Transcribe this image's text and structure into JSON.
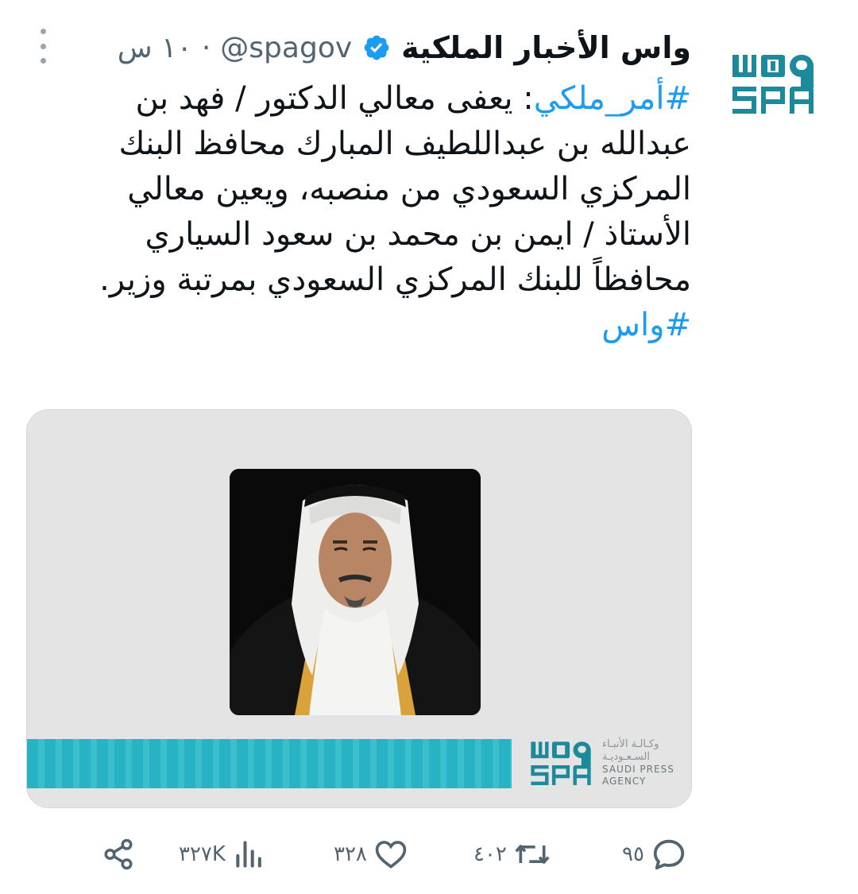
{
  "account": {
    "display_name": "واس الأخبار الملكية",
    "handle": "@spagov",
    "separator": "·",
    "time": "١٠ س",
    "avatar": "spa-logo",
    "verified_color": "#1d9bf0"
  },
  "tweet": {
    "hashtag_prefix": "#أمر_ملكي",
    "lines": [
      ": يعفى معالي الدكتور / فهد بن",
      "عبدالله بن عبداللطيف المبارك محافظ البنك",
      "المركزي السعودي من منصبه، ويعين معالي",
      "الأستاذ / ايمن بن محمد بن سعود السياري",
      "محافظاً للبنك المركزي السعودي بمرتبة وزير."
    ],
    "hashtag_suffix": "#واس"
  },
  "media": {
    "brand_short": "SPA",
    "agency_ar_line1": "وكـالـة الأنبـاء",
    "agency_ar_line2": "السـعـوديـة",
    "agency_en_line1": "SAUDI PRESS",
    "agency_en_line2": "AGENCY",
    "accent": "#27b3c3",
    "portrait": "royal-portrait"
  },
  "actions": {
    "replies": "٩٥",
    "retweets": "٤٠٢",
    "likes": "٣٢٨",
    "views": "٣٢٧K",
    "icon_color": "#536471"
  }
}
